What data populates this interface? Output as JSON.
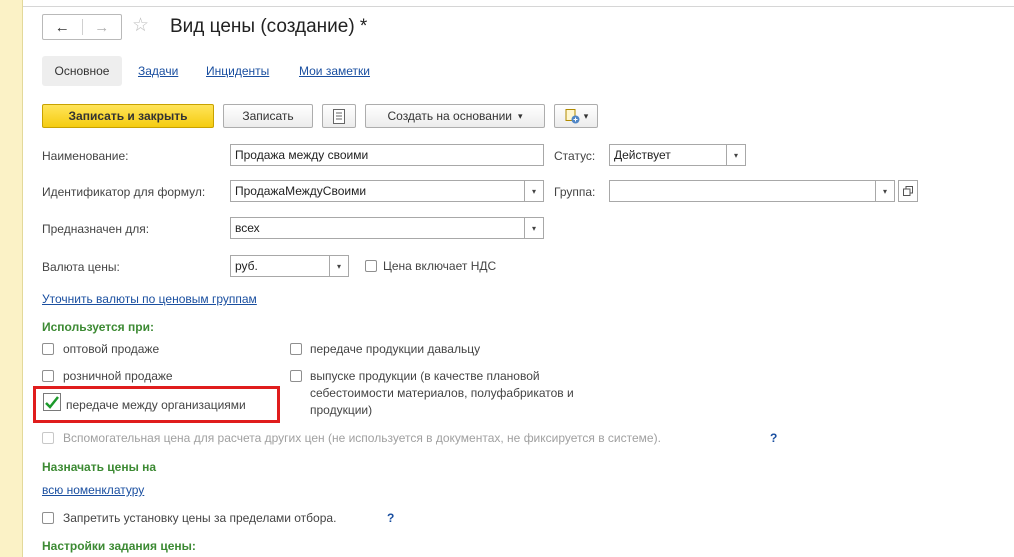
{
  "window": {
    "title": "Вид цены (создание) *"
  },
  "nav": {
    "back": "←",
    "forward": "→",
    "star": "☆"
  },
  "tabs": [
    "Основное",
    "Задачи",
    "Инциденты",
    "Мои заметки"
  ],
  "toolbar": {
    "save_close": "Записать и закрыть",
    "save": "Записать",
    "create_based": "Создать на основании",
    "dropdown_arrow": "▾"
  },
  "form": {
    "name_label": "Наименование:",
    "name_value": "Продажа между своими",
    "status_label": "Статус:",
    "status_value": "Действует",
    "id_label": "Идентификатор для формул:",
    "id_value": "ПродажаМеждуСвоими",
    "group_label": "Группа:",
    "group_value": "",
    "for_label": "Предназначен для:",
    "for_value": "всех",
    "currency_label": "Валюта цены:",
    "currency_value": "руб.",
    "vat_label": "Цена включает НДС",
    "vat_checked": false,
    "refine_link": "Уточнить валюты по ценовым группам"
  },
  "used_when": {
    "header": "Используется при:",
    "left": [
      {
        "label": "оптовой продаже",
        "checked": false
      },
      {
        "label": "розничной продаже",
        "checked": false
      },
      {
        "label": "передаче между организациями",
        "checked": true
      }
    ],
    "right": [
      {
        "label": "передаче продукции давальцу",
        "checked": false
      },
      {
        "label": "выпуске продукции (в качестве плановой",
        "label2": "себестоимости материалов, полуфабрикатов и",
        "label3": "продукции)",
        "checked": false
      }
    ]
  },
  "auxiliary": {
    "label": "Вспомогательная цена для расчета других цен (не используется в документах, не фиксируется в системе).",
    "help": "?"
  },
  "assign": {
    "header": "Назначать цены на",
    "link": "всю номенклатуру"
  },
  "forbid": {
    "label": "Запретить установку цены за пределами отбора.",
    "help": "?"
  },
  "settings": {
    "header": "Настройки задания цены:"
  },
  "colors": {
    "accent_yellow": "#f5cc10",
    "group_green": "#3c8a33",
    "link_blue": "#1a4fa0",
    "highlight_red": "#e01d1d",
    "check_green": "#1c9a2b"
  }
}
